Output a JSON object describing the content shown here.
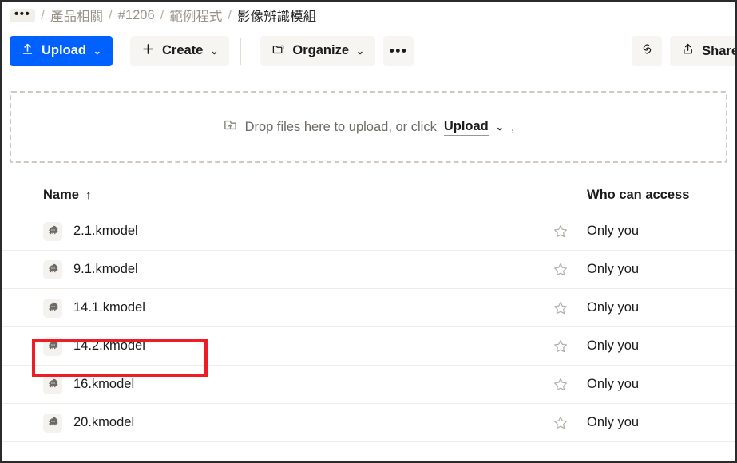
{
  "breadcrumb": {
    "overflow_label": "•••",
    "separator": "/",
    "items": [
      {
        "label": "產品相關",
        "current": false
      },
      {
        "label": "#1206",
        "current": false
      },
      {
        "label": "範例程式",
        "current": false
      },
      {
        "label": "影像辨識模組",
        "current": true
      }
    ]
  },
  "toolbar": {
    "upload_label": "Upload",
    "create_label": "Create",
    "organize_label": "Organize",
    "more_label": "•••",
    "share_label": "Share",
    "caret": "⌄",
    "primary_color": "#0061ff",
    "button_bg": "#f7f5f1"
  },
  "dropzone": {
    "text_before": "Drop files here to upload, or click",
    "upload_link": "Upload",
    "caret": "⌄",
    "text_after": ","
  },
  "table": {
    "headers": {
      "name": "Name",
      "sort_indicator": "↑",
      "access": "Who can access"
    },
    "rows": [
      {
        "name": "2.1.kmodel",
        "icon": "file-icon",
        "starred": false,
        "access": "Only you"
      },
      {
        "name": "9.1.kmodel",
        "icon": "file-icon",
        "starred": false,
        "access": "Only you"
      },
      {
        "name": "14.1.kmodel",
        "icon": "file-icon",
        "starred": false,
        "access": "Only you"
      },
      {
        "name": "14.2.kmodel",
        "icon": "file-icon",
        "starred": false,
        "access": "Only you"
      },
      {
        "name": "16.kmodel",
        "icon": "file-icon",
        "starred": false,
        "access": "Only you"
      },
      {
        "name": "20.kmodel",
        "icon": "file-icon",
        "starred": false,
        "access": "Only you"
      }
    ]
  },
  "annotation": {
    "target_row": "14.2.kmodel",
    "color": "#ee1c25"
  }
}
